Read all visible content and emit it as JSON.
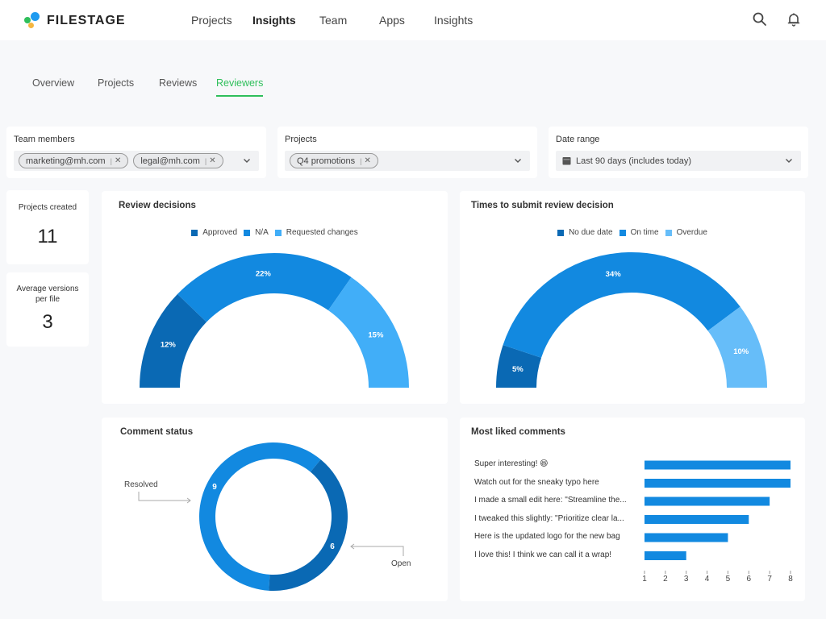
{
  "app": {
    "brand": "FILESTAGE",
    "nav": [
      {
        "label": "Projects",
        "active": false
      },
      {
        "label": "Insights",
        "active": true
      },
      {
        "label": "Team",
        "active": false
      },
      {
        "label": "Apps",
        "active": false
      },
      {
        "label": "Insights",
        "active": false
      }
    ],
    "icons": [
      "search-icon",
      "bell-icon"
    ]
  },
  "subtabs": [
    {
      "label": "Overview",
      "active": false
    },
    {
      "label": "Projects",
      "active": false
    },
    {
      "label": "Reviews",
      "active": false
    },
    {
      "label": "Reviewers",
      "active": true
    }
  ],
  "filters": {
    "team_members": {
      "label": "Team members",
      "chips": [
        "marketing@mh.com",
        "legal@mh.com"
      ]
    },
    "projects": {
      "label": "Projects",
      "chips": [
        "Q4 promotions"
      ]
    },
    "date_range": {
      "label": "Date range",
      "value": "Last 90 days (includes today)"
    }
  },
  "stats": {
    "projects_created": {
      "label": "Projects created",
      "value": "11"
    },
    "avg_versions": {
      "label": "Average versions per file",
      "value": "3"
    }
  },
  "colors": {
    "dark_blue": "#0a69b4",
    "mid_blue": "#1289e0",
    "light_blue": "#41aef8",
    "lighter_blue": "#66bdf9",
    "accent_green": "#2fbf5b"
  },
  "chart_data": [
    {
      "type": "pie",
      "title": "Review decisions",
      "variant": "semi-donut",
      "legend_position": "top-center",
      "labels": [
        "Approved",
        "N/A",
        "Requested changes"
      ],
      "values": [
        12,
        22,
        15
      ],
      "value_labels": [
        "12%",
        "22%",
        "15%"
      ],
      "colors": [
        "#0a69b4",
        "#1289e0",
        "#41aef8"
      ]
    },
    {
      "type": "pie",
      "title": "Times to submit review decision",
      "variant": "semi-donut",
      "legend_position": "top-center",
      "labels": [
        "No due date",
        "On time",
        "Overdue"
      ],
      "values": [
        5,
        34,
        10
      ],
      "value_labels": [
        "5%",
        "34%",
        "10%"
      ],
      "colors": [
        "#0a69b4",
        "#1289e0",
        "#66bdf9"
      ]
    },
    {
      "type": "pie",
      "title": "Comment status",
      "variant": "donut",
      "labels": [
        "Resolved",
        "Open"
      ],
      "values": [
        9,
        6
      ],
      "colors": [
        "#1289e0",
        "#0a69b4"
      ]
    },
    {
      "type": "bar",
      "orientation": "horizontal",
      "title": "Most liked comments",
      "categories": [
        "Super interesting! 😆",
        "Watch out for the sneaky typo here",
        "I made a small edit here: \"Streamline the...",
        "I tweaked this slightly: \"Prioritize clear la...",
        "Here is the updated logo for the new bag",
        "I love this! I think we can call it a wrap!"
      ],
      "values": [
        8,
        8,
        7,
        6,
        5,
        3
      ],
      "xlim": [
        1,
        8
      ],
      "xticks": [
        "1",
        "2",
        "3",
        "4",
        "5",
        "6",
        "7",
        "8"
      ],
      "color": "#1289e0"
    }
  ]
}
